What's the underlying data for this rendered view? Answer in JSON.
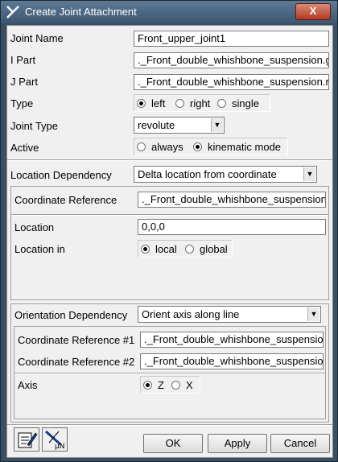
{
  "window": {
    "title": "Create Joint Attachment",
    "close_label": "X"
  },
  "fields": {
    "joint_name_label": "Joint Name",
    "joint_name_value": "Front_upper_joint1",
    "i_part_label": "I Part",
    "i_part_value": "._Front_double_whishbone_suspension.g",
    "j_part_label": "J Part",
    "j_part_value": "._Front_double_whishbone_suspension.r",
    "type_label": "Type",
    "type_options": [
      "left",
      "right",
      "single"
    ],
    "type_selected": "left",
    "joint_type_label": "Joint Type",
    "joint_type_value": "revolute",
    "active_label": "Active",
    "active_options": [
      "always",
      "kinematic mode"
    ],
    "active_selected": "kinematic mode"
  },
  "location": {
    "dependency_label": "Location Dependency",
    "dependency_value": "Delta location from coordinate",
    "coord_ref_label": "Coordinate Reference",
    "coord_ref_value": "._Front_double_whishbone_suspension",
    "location_label": "Location",
    "location_value": "0,0,0",
    "location_in_label": "Location in",
    "location_in_options": [
      "local",
      "global"
    ],
    "location_in_selected": "local"
  },
  "orientation": {
    "dependency_label": "Orientation Dependency",
    "dependency_value": "Orient axis along line",
    "coord_ref1_label": "Coordinate Reference #1",
    "coord_ref1_value": "._Front_double_whishbone_suspensio",
    "coord_ref2_label": "Coordinate Reference #2",
    "coord_ref2_value": "._Front_double_whishbone_suspensio",
    "axis_label": "Axis",
    "axis_options": [
      "Z",
      "X"
    ],
    "axis_selected": "Z"
  },
  "buttons": {
    "ok": "OK",
    "apply": "Apply",
    "cancel": "Cancel"
  },
  "icons": {
    "edit": "edit-notes-icon",
    "friction": "friction-mu-icon",
    "friction_text": "μN"
  }
}
